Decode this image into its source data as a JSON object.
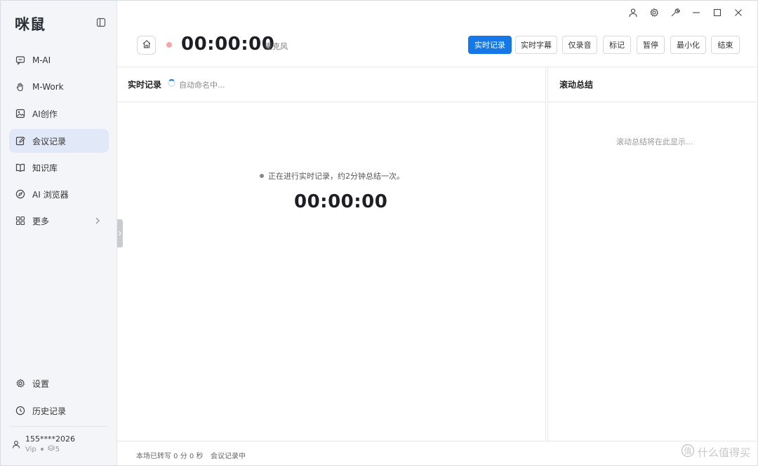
{
  "app": {
    "logo": "咪鼠"
  },
  "sidebar": {
    "items": [
      {
        "label": "M-AI",
        "icon": "chat-icon"
      },
      {
        "label": "M-Work",
        "icon": "hand-icon"
      },
      {
        "label": "AI创作",
        "icon": "image-icon"
      },
      {
        "label": "会议记录",
        "icon": "note-edit-icon",
        "active": true
      },
      {
        "label": "知识库",
        "icon": "book-icon"
      },
      {
        "label": "AI 浏览器",
        "icon": "compass-icon"
      },
      {
        "label": "更多",
        "icon": "grid-icon"
      }
    ],
    "settings_label": "设置",
    "history_label": "历史记录",
    "user": {
      "phone": "155****2026",
      "tier": "Vip",
      "points": "5"
    }
  },
  "toolbar": {
    "timer": "00:00:00",
    "mic_label": "麦克风",
    "buttons": [
      "实时记录",
      "实时字幕",
      "仅录音",
      "标记",
      "暂停",
      "最小化",
      "结束"
    ]
  },
  "transcript": {
    "title": "实时记录",
    "auto_name": "自动命名中...",
    "status": "正在进行实时记录，约2分钟总结一次。",
    "timer": "00:00:00"
  },
  "summary": {
    "title": "滚动总结",
    "placeholder": "滚动总结将在此显示..."
  },
  "footer": {
    "transcribed": "本场已转写 0 分 0 秒",
    "state": "会议记录中"
  },
  "watermark": "什么值得买",
  "colors": {
    "accent": "#1677e6",
    "active_bg": "#e1e8f7",
    "rec_dot": "#f4a7a7"
  }
}
